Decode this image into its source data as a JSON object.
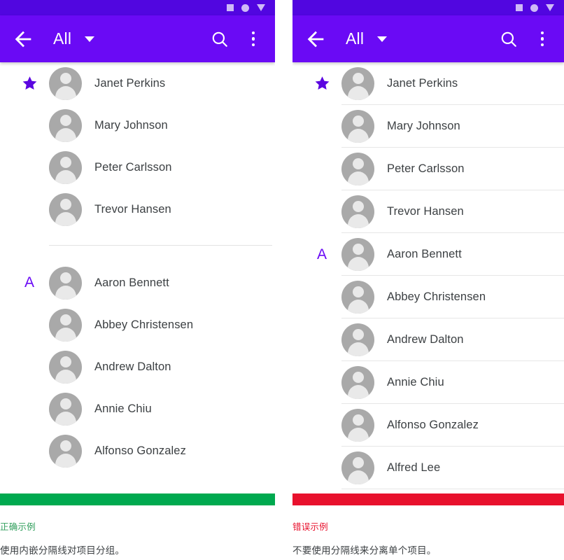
{
  "theme": {
    "appbar_color": "#6a0af5",
    "statusbar_color": "#5106e0",
    "accent_purple": "#6a0af5",
    "good_bar_color": "#00a94f",
    "bad_bar_color": "#e8112d",
    "divider_color": "#e7e7e7",
    "avatar_color": "#a9a9a9",
    "text_color": "#3c4043"
  },
  "appbar": {
    "back_icon": "arrow-back-icon",
    "title": "All",
    "caret_icon": "chevron-down-icon",
    "search_icon": "search-icon",
    "overflow_icon": "more-vert-icon"
  },
  "statusbar": {
    "icons": [
      "square-icon",
      "circle-icon",
      "triangle-down-icon"
    ]
  },
  "left_panel": {
    "example_type": "correct",
    "bar_color": "#00a94f",
    "caption_label": "正确示例",
    "caption_desc": "使用内嵌分隔线对项目分组。",
    "groups": [
      {
        "marker": "★",
        "marker_name": "star-icon",
        "contacts": [
          {
            "name": "Janet Perkins"
          },
          {
            "name": "Mary Johnson"
          },
          {
            "name": "Peter Carlsson"
          },
          {
            "name": "Trevor Hansen"
          }
        ]
      },
      {
        "marker": "A",
        "marker_name": "section-letter-a",
        "contacts": [
          {
            "name": "Aaron Bennett"
          },
          {
            "name": "Abbey Christensen"
          },
          {
            "name": "Andrew Dalton"
          },
          {
            "name": "Annie Chiu"
          },
          {
            "name": "Alfonso Gonzalez"
          }
        ]
      }
    ]
  },
  "right_panel": {
    "example_type": "incorrect",
    "bar_color": "#e8112d",
    "caption_label": "错误示例",
    "caption_desc": "不要使用分隔线来分离单个项目。",
    "rows": [
      {
        "name": "Janet Perkins",
        "marker": "★",
        "marker_name": "star-icon"
      },
      {
        "name": "Mary Johnson",
        "marker": "",
        "marker_name": ""
      },
      {
        "name": "Peter Carlsson",
        "marker": "",
        "marker_name": ""
      },
      {
        "name": "Trevor Hansen",
        "marker": "",
        "marker_name": ""
      },
      {
        "name": "Aaron Bennett",
        "marker": "A",
        "marker_name": "section-letter-a"
      },
      {
        "name": "Abbey Christensen",
        "marker": "",
        "marker_name": ""
      },
      {
        "name": "Andrew Dalton",
        "marker": "",
        "marker_name": ""
      },
      {
        "name": "Annie Chiu",
        "marker": "",
        "marker_name": ""
      },
      {
        "name": "Alfonso Gonzalez",
        "marker": "",
        "marker_name": ""
      },
      {
        "name": "Alfred Lee",
        "marker": "",
        "marker_name": ""
      }
    ]
  }
}
